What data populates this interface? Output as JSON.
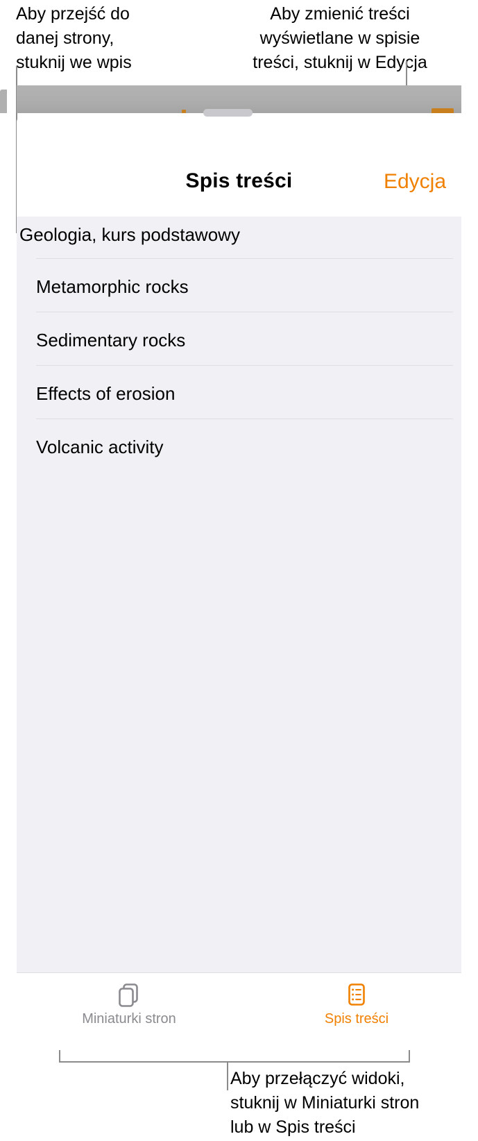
{
  "callouts": {
    "top_left": "Aby przejść do\ndanej strony,\nstuknij we wpis",
    "top_right": "Aby zmienić treści\nwyświetlane w spisie\ntreści, stuknij w Edycja",
    "bottom": "Aby przełączyć widoki,\nstuknij w Miniaturki stron\nlub w Spis treści"
  },
  "sheet": {
    "title": "Spis treści",
    "edit_label": "Edycja"
  },
  "toc": {
    "section_header": "Geologia, kurs podstawowy",
    "entries": [
      {
        "label": "Metamorphic rocks"
      },
      {
        "label": "Sedimentary rocks"
      },
      {
        "label": "Effects of erosion"
      },
      {
        "label": "Volcanic activity"
      }
    ]
  },
  "tabbar": {
    "tabs": [
      {
        "label": "Miniaturki stron",
        "icon": "pages-thumbnails-icon",
        "active": false
      },
      {
        "label": "Spis treści",
        "icon": "table-of-contents-icon",
        "active": true
      }
    ]
  },
  "colors": {
    "accent": "#f08000",
    "inactive": "#8a8a8f",
    "list_bg": "#f0f0f5",
    "separator": "#dddde2",
    "toolbar": "#adadad",
    "leader": "#8b8b8b"
  }
}
